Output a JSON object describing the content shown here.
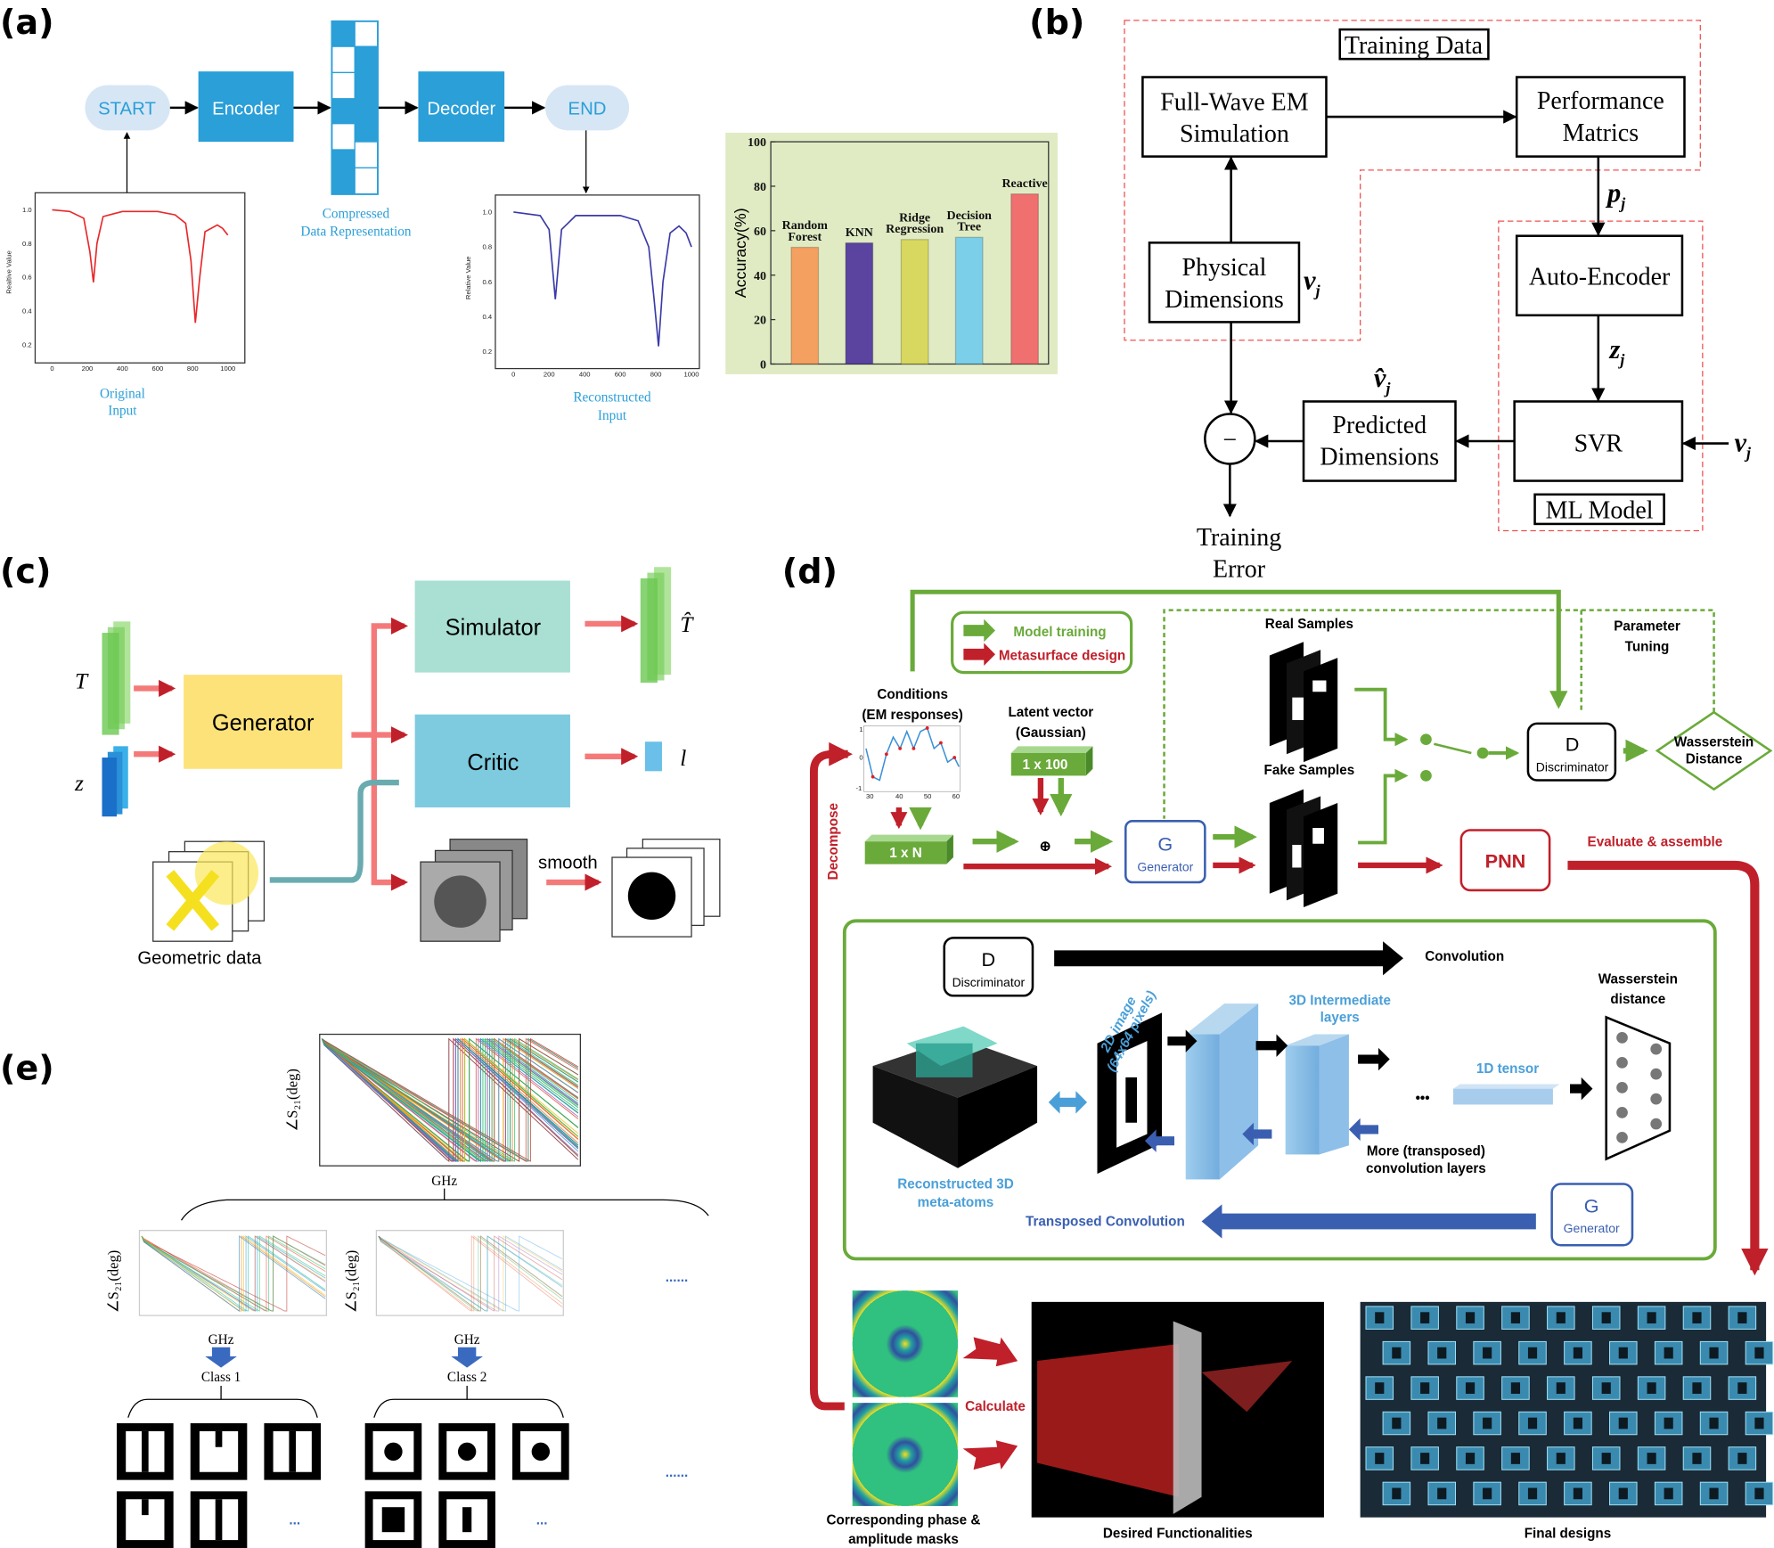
{
  "panel_labels": {
    "a": "(a)",
    "b": "(b)",
    "c": "(c)",
    "d": "(d)",
    "e": "(e)"
  },
  "panel_a": {
    "start": "START",
    "encoder": "Encoder",
    "decoder": "Decoder",
    "end": "END",
    "compressed": [
      "Compressed",
      "Data Representation"
    ],
    "original": [
      "Original",
      "Input"
    ],
    "reconstructed": [
      "Reconstructed",
      "Input"
    ],
    "colors": {
      "block": "#2a9fd8",
      "pill": "#d6e6f5",
      "caption": "#2a9fd8",
      "bar_bg": "#e0ebc4"
    }
  },
  "panel_b": {
    "training_data": "Training Data",
    "full_wave": [
      "Full-Wave EM",
      "Simulation"
    ],
    "performance": [
      "Performance",
      "Matrics"
    ],
    "physical": [
      "Physical",
      "Dimensions"
    ],
    "auto_encoder": "Auto-Encoder",
    "svr": "SVR",
    "ml_model": "ML Model",
    "predicted": [
      "Predicted",
      "Dimensions"
    ],
    "training_error": [
      "Training",
      "Error"
    ],
    "v_j": "v",
    "p_j": "p",
    "z_j": "z",
    "v_hat_j": "v̂",
    "sub_j": "j",
    "minus": "−"
  },
  "panel_c": {
    "T": "T",
    "z": "z",
    "T_hat": "T̂",
    "l": "l",
    "generator": "Generator",
    "simulator": "Simulator",
    "critic": "Critic",
    "smooth": "smooth",
    "geometric": "Geometric data"
  },
  "panel_d": {
    "legend_training": "Model training",
    "legend_design": "Metasurface design",
    "conditions": [
      "Conditions",
      "(EM responses)"
    ],
    "latent": [
      "Latent vector",
      "(Gaussian)"
    ],
    "vec_100": "1 x 100",
    "vec_n": "1 x N",
    "real_samples": "Real Samples",
    "fake_samples": "Fake Samples",
    "parameter_tuning": [
      "Parameter",
      "Tuning"
    ],
    "d_letter": "D",
    "discriminator": "Discriminator",
    "wasserstein_diamond": [
      "Wasserstein",
      "Distance"
    ],
    "g_letter": "G",
    "generator": "Generator",
    "pnn": "PNN",
    "evaluate": "Evaluate & assemble",
    "decompose": "Decompose",
    "convolution": "Convolution",
    "wasserstein_nn": [
      "Wasserstein",
      "distance"
    ],
    "image_2d": [
      "2D image",
      "(64x64 pixels)"
    ],
    "intermediate": [
      "3D Intermediate",
      "layers"
    ],
    "tensor_1d": "1D tensor",
    "more_layers": [
      "More (transposed)",
      "convolution layers"
    ],
    "meta_atoms": [
      "Reconstructed 3D",
      "meta-atoms"
    ],
    "transposed": "Transposed Convolution",
    "ellipsis": "•••",
    "calculate": "Calculate",
    "masks": [
      "Corresponding phase &",
      "amplitude masks"
    ],
    "desired": "Desired Functionalities",
    "final": "Final designs",
    "cond_ticks_x": [
      "30",
      "40",
      "50",
      "60"
    ],
    "cond_ticks_y": [
      "1",
      "0",
      "-1"
    ],
    "colors": {
      "green": "#6aaa3a",
      "red": "#c0202a",
      "blue": "#3a5fb0",
      "light_blue": "#4a9fd8"
    }
  },
  "panel_e": {
    "ylabel": "∠S₂₁(deg)",
    "xlabel": "GHz",
    "class1": "Class 1",
    "class2": "Class 2",
    "more": "......",
    "ellipsis": "..."
  },
  "chart_data": [
    {
      "type": "bar",
      "categories": [
        "Random Forest",
        "KNN",
        "Ridge Regression",
        "Decision Tree",
        "Reactive"
      ],
      "category_lines": [
        [
          "Random",
          "Forest"
        ],
        [
          "KNN"
        ],
        [
          "Ridge",
          "Regression"
        ],
        [
          "Decision",
          "Tree"
        ],
        [
          "Reactive"
        ]
      ],
      "values": [
        52.5,
        54.5,
        56,
        57,
        76.5
      ],
      "colors": [
        "#f4a060",
        "#5a44a0",
        "#d8d860",
        "#7ccfe8",
        "#f07070"
      ],
      "label_colors": [
        "#f08a3a",
        "#6a3aa0",
        "#7a7030",
        "#3aa8e0",
        "#e02020"
      ],
      "ylabel": "Accuracy(%)",
      "ylim": [
        0,
        100
      ],
      "yticks": [
        "0",
        "20",
        "40",
        "60",
        "80",
        "100"
      ],
      "grid": false
    },
    {
      "type": "line",
      "ylabel": "Realtive Value",
      "xlim": [
        0,
        1000
      ],
      "ylim": [
        0.1,
        1.1
      ],
      "xticks": [
        "0",
        "200",
        "400",
        "600",
        "800",
        "1000"
      ],
      "yticks": [
        "0.2",
        "0.4",
        "0.6",
        "0.8",
        "1.0"
      ],
      "color": "#e8282a",
      "x": [
        0,
        100,
        180,
        215,
        235,
        255,
        290,
        400,
        600,
        700,
        760,
        790,
        815,
        840,
        870,
        940,
        970,
        1000
      ],
      "y": [
        1.0,
        0.99,
        0.95,
        0.75,
        0.57,
        0.8,
        0.96,
        0.99,
        0.99,
        0.97,
        0.92,
        0.7,
        0.33,
        0.6,
        0.87,
        0.91,
        0.89,
        0.85
      ]
    },
    {
      "type": "line",
      "ylabel": "Relative Value",
      "xlim": [
        0,
        1000
      ],
      "ylim": [
        0.1,
        1.1
      ],
      "xticks": [
        "0",
        "200",
        "400",
        "600",
        "800",
        "1000"
      ],
      "yticks": [
        "0.2",
        "0.4",
        "0.6",
        "0.8",
        "1.0"
      ],
      "color": "#3a3aa8",
      "x": [
        0,
        150,
        200,
        235,
        270,
        350,
        600,
        700,
        760,
        790,
        815,
        840,
        880,
        930,
        970,
        1000
      ],
      "y": [
        1.0,
        0.98,
        0.9,
        0.5,
        0.9,
        0.98,
        0.98,
        0.95,
        0.8,
        0.5,
        0.23,
        0.6,
        0.88,
        0.92,
        0.88,
        0.8
      ]
    }
  ]
}
